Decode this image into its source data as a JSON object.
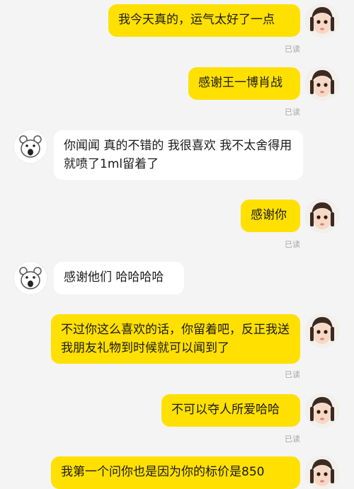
{
  "messages": [
    {
      "side": "me",
      "text": "我今天真的，运气太好了一点",
      "status": "已读"
    },
    {
      "side": "me",
      "text": "感谢王一博肖战",
      "status": "已读"
    },
    {
      "side": "them",
      "text": "你闻闻 真的不错的 我很喜欢 我不太舍得用 就喷了1ml留着了"
    },
    {
      "side": "me",
      "text": "感谢你",
      "status": "已读"
    },
    {
      "side": "them",
      "text": "感谢他们 哈哈哈哈"
    },
    {
      "side": "me",
      "text": "不过你这么喜欢的话，你留着吧，反正我送我朋友礼物到时候就可以闻到了",
      "status": "已读"
    },
    {
      "side": "me",
      "text": "不可以夺人所爱哈哈",
      "status": "已读"
    },
    {
      "side": "me",
      "text": "我第一个问你也是因为你的标价是850"
    }
  ],
  "avatars": {
    "me": "girl-portrait-avatar",
    "them": "cartoon-bear-avatar"
  },
  "colors": {
    "background": "#f4f4f4",
    "my_bubble": "#ffe000",
    "their_bubble": "#ffffff",
    "read_receipt": "#a6a6a6"
  }
}
